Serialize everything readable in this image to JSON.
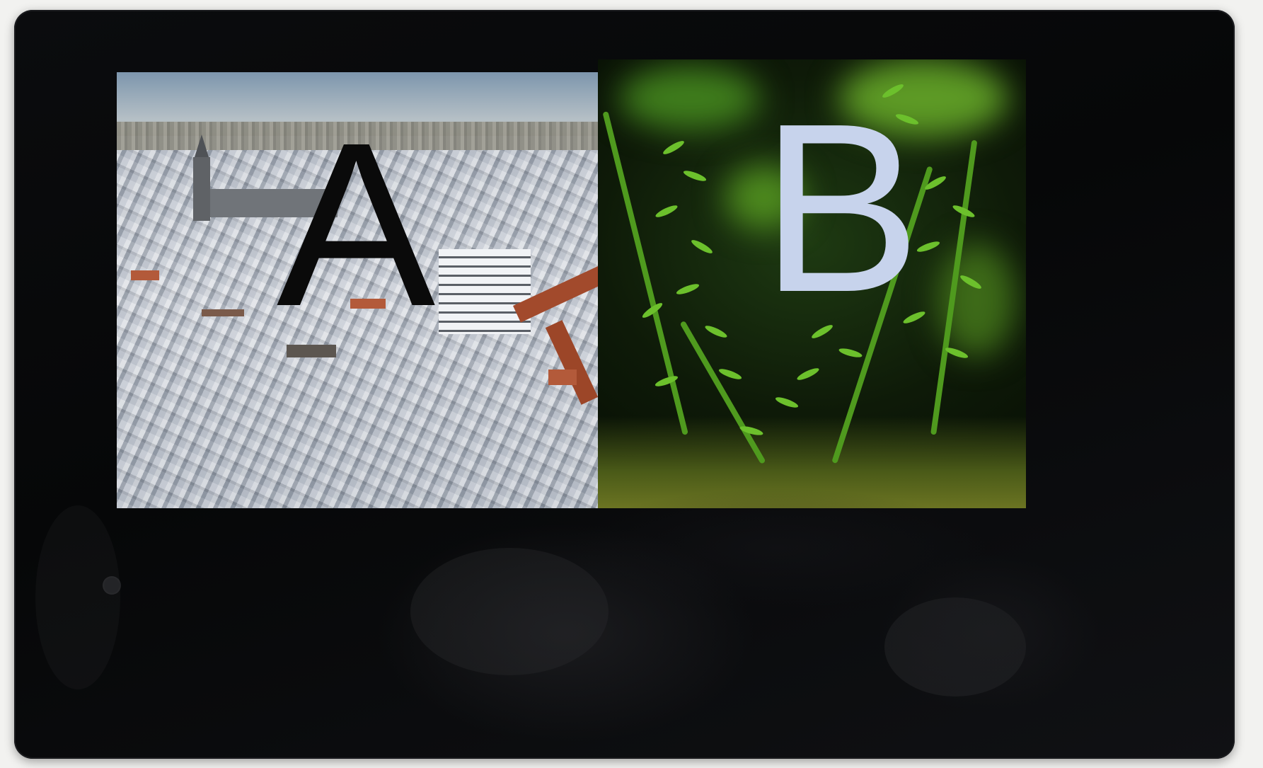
{
  "panels": {
    "left": {
      "label": "A",
      "label_color": "#0a0a0a",
      "scene": "city-rooftops"
    },
    "right": {
      "label": "B",
      "label_color": "#c7d3ec",
      "scene": "fern-plant"
    }
  },
  "colors": {
    "device_bezel": "#08090b",
    "background": "#f2f2f0"
  }
}
